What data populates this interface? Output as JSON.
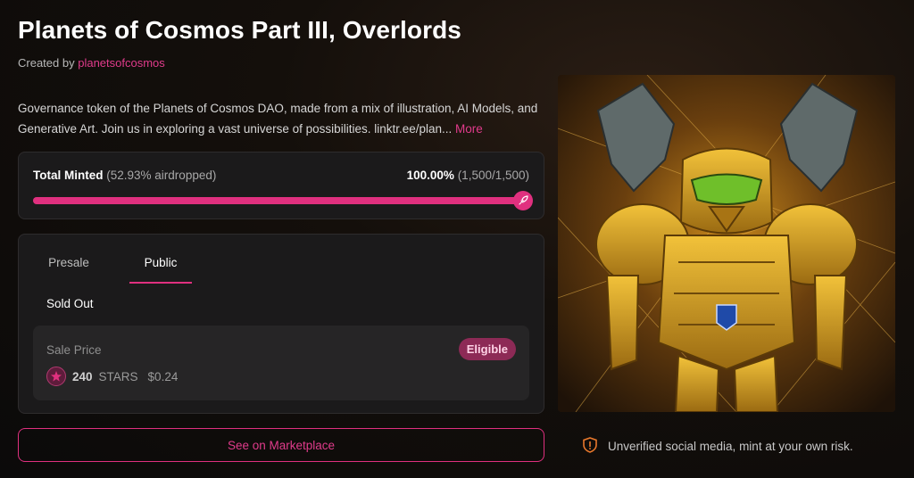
{
  "header": {
    "title": "Planets of Cosmos Part III, Overlords",
    "created_by_label": "Created by",
    "creator": "planetsofcosmos"
  },
  "description": {
    "text": "Governance token of the Planets of Cosmos DAO, made from a mix of illustration, AI Models, and Generative Art. Join us in exploring a vast universe of possibilities. linktr.ee/plan...",
    "more_label": "More"
  },
  "mint": {
    "label": "Total Minted",
    "airdropped": "(52.93% airdropped)",
    "percent": "100.00%",
    "count": "(1,500/1,500)",
    "progress": 1.0
  },
  "sale": {
    "tabs": [
      {
        "label": "Presale",
        "active": false
      },
      {
        "label": "Public",
        "active": true
      }
    ],
    "status": "Sold Out",
    "price_label": "Sale Price",
    "eligible_badge": "Eligible",
    "amount": "240",
    "unit": "STARS",
    "usd": "$0.24"
  },
  "marketplace_button": "See on Marketplace",
  "warning": "Unverified social media, mint at your own risk.",
  "colors": {
    "accent": "#e0307f",
    "background": "#0b0a0a",
    "card": "#1b1a1b"
  }
}
